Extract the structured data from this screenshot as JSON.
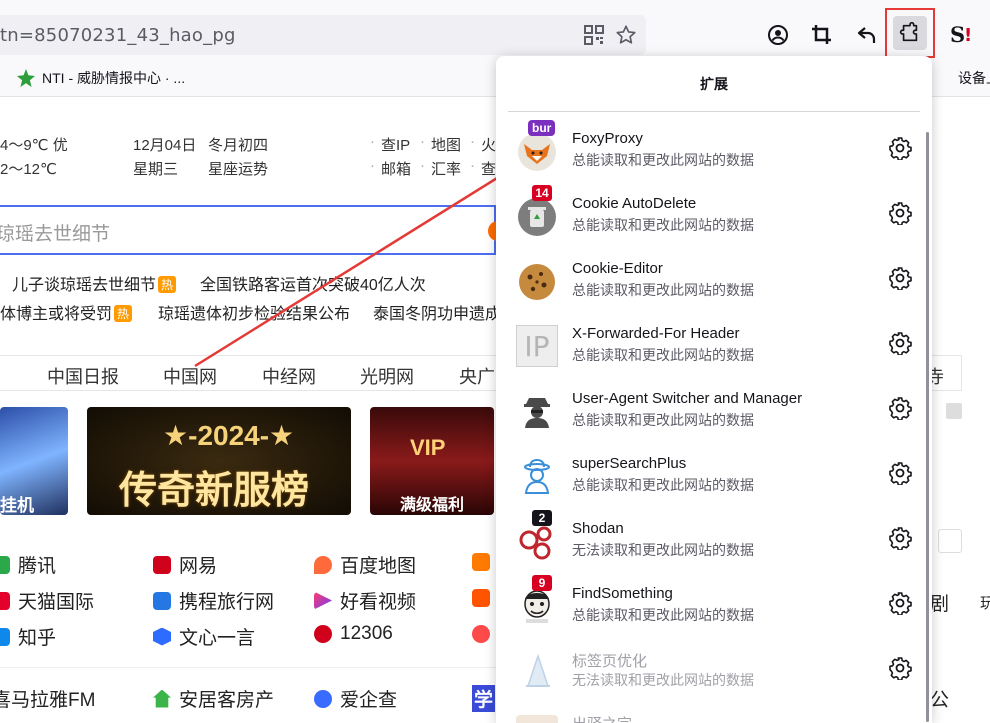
{
  "browser": {
    "url": "tn=85070231_43_hao_pg",
    "bookmark": "NTI - 威胁情报中心 · ...",
    "bookmark_right": "设备上的"
  },
  "page": {
    "weather": {
      "line1": "4～9℃  优",
      "line2": "2～12℃"
    },
    "date": {
      "day": "12月04日",
      "lunar": "冬月初四",
      "weekday": "星期三",
      "horoscope": "星座运势"
    },
    "quick_links": [
      {
        "a": "查IP",
        "b": "地图",
        "c": "火"
      },
      {
        "a": "邮箱",
        "b": "汇率",
        "c": "查"
      }
    ],
    "search_hint": "琼瑶去世细节",
    "news": [
      {
        "text": "儿子谈琼瑶去世细节",
        "hot": "热"
      },
      {
        "text": "全国铁路客运首次突破40亿人次"
      },
      {
        "text": "体博主或将受罚",
        "hot": "热"
      },
      {
        "text": "琼瑶遗体初步检验结果公布"
      },
      {
        "text": "泰国冬阴功申遗成"
      }
    ],
    "site_nav": [
      "中国日报",
      "中国网",
      "中经网",
      "光明网",
      "央广"
    ],
    "site_nav_right": "寺",
    "banners": {
      "left_text": "挂机",
      "center_top": "2024",
      "center_main": "传奇新服榜",
      "right_text": "满级福利",
      "right_badge": "VIP"
    },
    "grid": [
      [
        "腾讯",
        "网易",
        "百度地图"
      ],
      [
        "天猫国际",
        "携程旅行网",
        "好看视频"
      ],
      [
        "知乎",
        "文心一言",
        "12306"
      ]
    ],
    "bottom": [
      "喜马拉雅FM",
      "安居客房产",
      "爱企查",
      "学"
    ],
    "right_edge": {
      "a": "剧",
      "b": "公",
      "c": "玩"
    }
  },
  "extensions_panel": {
    "title": "扩展",
    "items": [
      {
        "name": "FoxyProxy",
        "desc": "总能读取和更改此网站的数据",
        "badge": "bur",
        "badge_style": "purple",
        "icon": "fox-icon"
      },
      {
        "name": "Cookie AutoDelete",
        "desc": "总能读取和更改此网站的数据",
        "badge": "14",
        "icon": "trash-icon"
      },
      {
        "name": "Cookie-Editor",
        "desc": "总能读取和更改此网站的数据",
        "icon": "cookie-icon"
      },
      {
        "name": "X-Forwarded-For Header",
        "desc": "总能读取和更改此网站的数据",
        "icon": "ip-icon",
        "icon_text": "IP"
      },
      {
        "name": "User-Agent Switcher and Manager",
        "desc": "总能读取和更改此网站的数据",
        "icon": "agent-icon"
      },
      {
        "name": "superSearchPlus",
        "desc": "总能读取和更改此网站的数据",
        "icon": "detective-icon"
      },
      {
        "name": "Shodan",
        "desc": "无法读取和更改此网站的数据",
        "badge": "2",
        "badge_style": "dark",
        "icon": "shodan-icon"
      },
      {
        "name": "FindSomething",
        "desc": "总能读取和更改此网站的数据",
        "badge": "9",
        "icon": "face-icon"
      },
      {
        "name": "标签页优化",
        "desc": "无法读取和更改此网站的数据",
        "disabled": true,
        "icon": "tab-icon"
      },
      {
        "name": "出驿之宗",
        "desc": "",
        "disabled": true,
        "icon": "box-icon"
      }
    ]
  },
  "colors": {
    "highlight": "#e53935",
    "arrow": "#e53935",
    "accent": "#4e6ef2"
  }
}
